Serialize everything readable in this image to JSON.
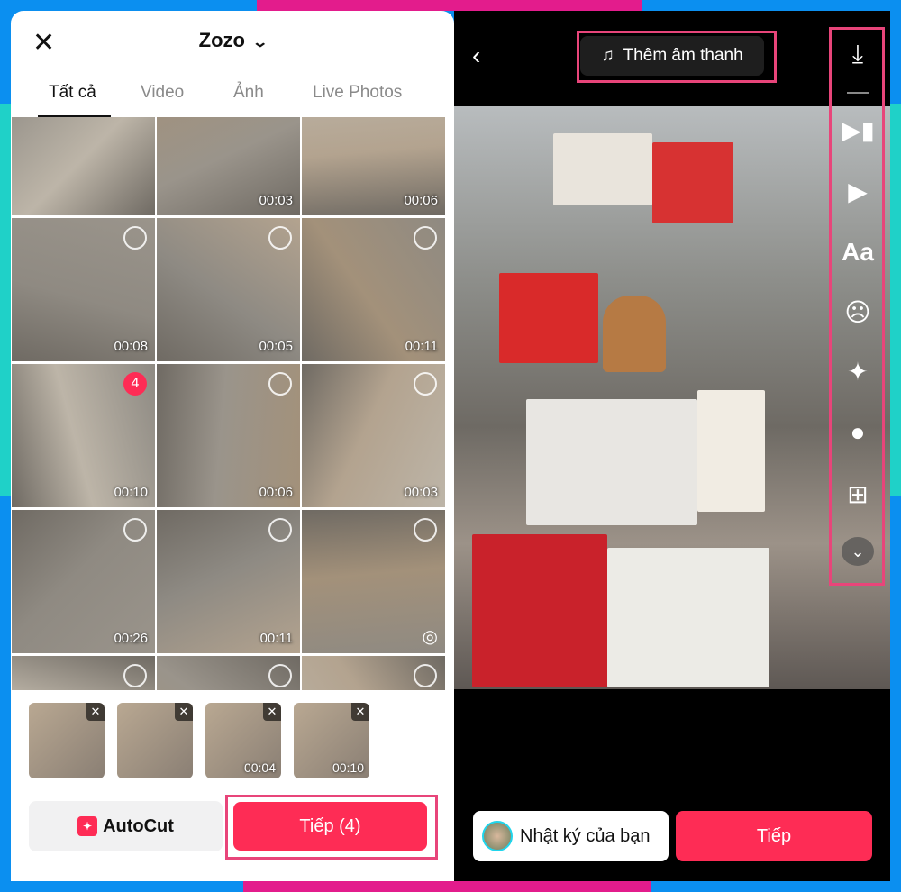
{
  "colors": {
    "accent": "#fe2c55",
    "highlight": "#e8457a",
    "frame_blue": "#0b8ff0",
    "frame_pink": "#e31c8c",
    "frame_teal": "#1fd1c8"
  },
  "gallery": {
    "close_icon": "close-icon",
    "album": "Zozo",
    "tabs": [
      {
        "label": "Tất cả",
        "active": true
      },
      {
        "label": "Video"
      },
      {
        "label": "Ảnh"
      },
      {
        "label": "Live Photos"
      }
    ],
    "cells": [
      {
        "duration": ""
      },
      {
        "duration": "00:03"
      },
      {
        "duration": "00:06"
      },
      {
        "duration": "00:08",
        "select": "circle"
      },
      {
        "duration": "00:05",
        "select": "circle"
      },
      {
        "duration": "00:11",
        "select": "circle"
      },
      {
        "duration": "00:10",
        "badge": "4"
      },
      {
        "duration": "00:06",
        "select": "circle"
      },
      {
        "duration": "00:03",
        "select": "circle"
      },
      {
        "duration": "00:26",
        "select": "circle"
      },
      {
        "duration": "00:11",
        "select": "circle"
      },
      {
        "duration": "",
        "select": "circle",
        "icon": "live-photo-icon"
      },
      {
        "duration": "",
        "select": "circle"
      },
      {
        "duration": "",
        "select": "circle"
      },
      {
        "duration": "",
        "select": "circle"
      }
    ],
    "selected": [
      {
        "duration": ""
      },
      {
        "duration": ""
      },
      {
        "duration": "00:04"
      },
      {
        "duration": "00:10"
      }
    ],
    "autocut_label": "AutoCut",
    "next_label": "Tiếp (4)"
  },
  "editor": {
    "add_sound_label": "Thêm âm thanh",
    "tools": [
      "download-icon",
      "trim-icon",
      "templates-icon",
      "text-icon",
      "sticker-icon",
      "effects-icon",
      "filters-icon",
      "add-clip-icon",
      "more-icon"
    ],
    "text_tool_label": "Aa",
    "diary_label": "Nhật ký của bạn",
    "next_label": "Tiếp"
  }
}
